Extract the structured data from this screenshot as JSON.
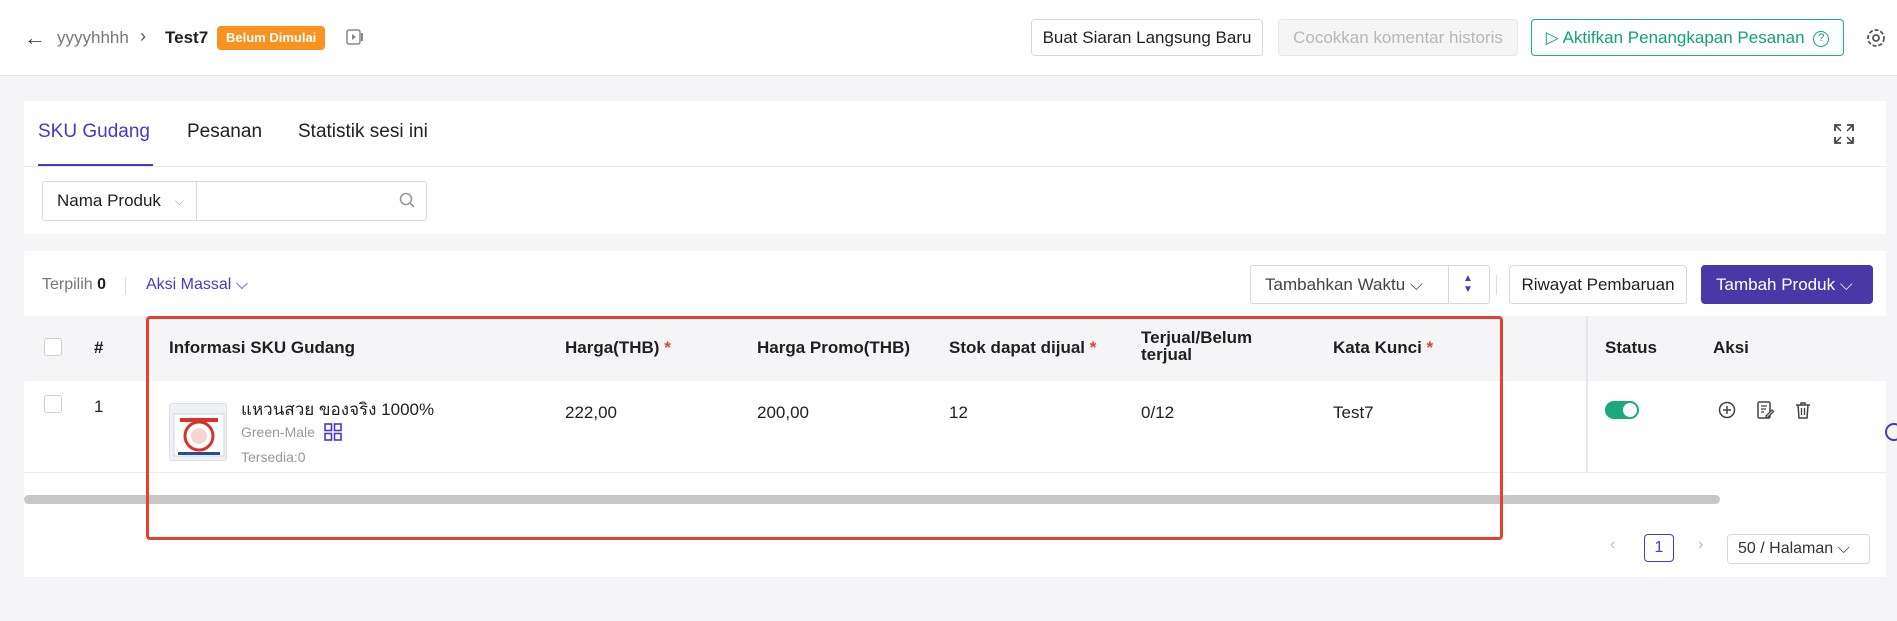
{
  "header": {
    "breadcrumb_parent": "yyyyhhhh",
    "breadcrumb_current": "Test7",
    "status_badge": "Belum Dimulai",
    "btn_new_live": "Buat Siaran Langsung Baru",
    "btn_match_comments": "Cocokkan komentar historis",
    "btn_enable_capture": "Aktifkan Penangkapan Pesanan"
  },
  "tabs": [
    "SKU Gudang",
    "Pesanan",
    "Statistik sesi ini"
  ],
  "filter": {
    "field_label": "Nama Produk",
    "search_value": ""
  },
  "toolbar": {
    "selected_label": "Terpilih",
    "selected_count": "0",
    "bulk_action": "Aksi Massal",
    "add_time": "Tambahkan Waktu",
    "history": "Riwayat Pembaruan",
    "add_product": "Tambah Produk"
  },
  "table": {
    "columns": {
      "index": "#",
      "sku_info": "Informasi SKU Gudang",
      "price": "Harga(THB)",
      "promo_price": "Harga Promo(THB)",
      "stock": "Stok dapat dijual",
      "sold": "Terjual/Belum terjual",
      "keyword": "Kata Kunci",
      "status": "Status",
      "actions": "Aksi"
    },
    "rows": [
      {
        "index": "1",
        "name": "แหวนสวย ของจริง 1000%",
        "variant": "Green-Male",
        "available": "Tersedia:0",
        "price": "222,00",
        "promo_price": "200,00",
        "stock": "12",
        "sold": "0/12",
        "keyword": "Test7",
        "status_on": true
      }
    ]
  },
  "pagination": {
    "current_page": "1",
    "page_size": "50 / Halaman"
  },
  "colors": {
    "accent": "#4a37c8",
    "primary_button": "#4a37a8",
    "badge": "#f7931e",
    "toggle_on": "#19a97b",
    "highlight_box": "#e5412f"
  }
}
